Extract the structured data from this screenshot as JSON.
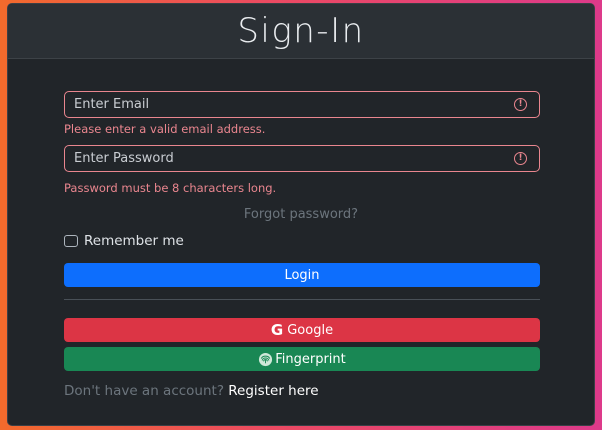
{
  "title": "Sign-In",
  "email": {
    "placeholder": "Enter Email",
    "value": "",
    "error": "Please enter a valid email address.",
    "icon": "exclamation-circle-icon"
  },
  "password": {
    "placeholder": "Enter Password",
    "value": "",
    "error": "Password must be 8 characters long.",
    "icon": "exclamation-circle-icon"
  },
  "forgot_link": "Forgot password?",
  "remember_label": "Remember me",
  "remember_checked": false,
  "login_label": "Login",
  "google_label": "Google",
  "fingerprint_label": "Fingerprint",
  "register_prompt": "Don't have an account?",
  "register_link": "Register here",
  "colors": {
    "error": "#ea868f",
    "primary": "#0d6efd",
    "danger": "#dc3545",
    "success": "#198754",
    "card_bg": "#212529"
  }
}
